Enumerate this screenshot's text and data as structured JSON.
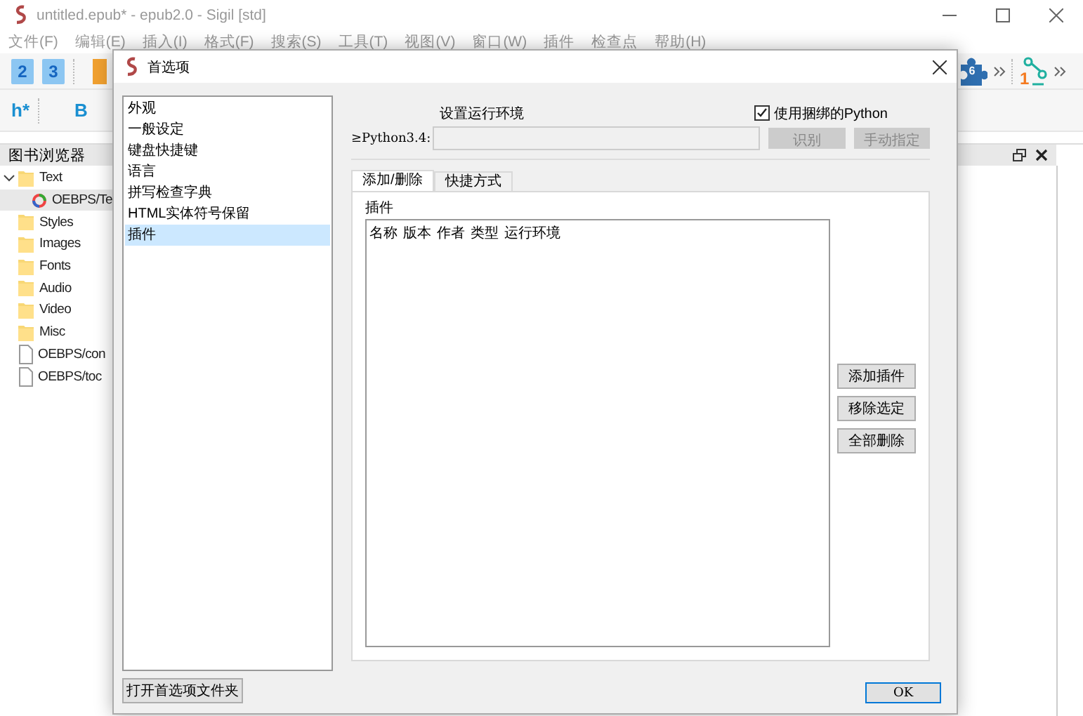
{
  "window": {
    "title": "untitled.epub* - epub2.0 - Sigil [std]"
  },
  "menu": [
    "文件(F)",
    "编辑(E)",
    "插入(I)",
    "格式(F)",
    "搜索(S)",
    "工具(T)",
    "视图(V)",
    "窗口(W)",
    "插件",
    "检查点",
    "帮助(H)"
  ],
  "toolbar_top": {
    "headings": [
      "2",
      "3"
    ],
    "plugin_badge": "6",
    "checkpoint_badge": "1"
  },
  "toolbar_second": {
    "heading_menu": "h*",
    "bold": "B"
  },
  "book_browser": {
    "title": "图书浏览器",
    "tree": [
      {
        "label": "Text",
        "kind": "folder",
        "children": [
          {
            "label": "OEBPS/Te",
            "kind": "html"
          }
        ]
      },
      {
        "label": "Styles",
        "kind": "folder"
      },
      {
        "label": "Images",
        "kind": "folder"
      },
      {
        "label": "Fonts",
        "kind": "folder"
      },
      {
        "label": "Audio",
        "kind": "folder"
      },
      {
        "label": "Video",
        "kind": "folder"
      },
      {
        "label": "Misc",
        "kind": "folder"
      },
      {
        "label": "OEBPS/con",
        "kind": "file"
      },
      {
        "label": "OEBPS/toc",
        "kind": "file"
      }
    ]
  },
  "dialog": {
    "title": "首选项",
    "categories": [
      {
        "label": "外观",
        "selected": false
      },
      {
        "label": "一般设定",
        "selected": false
      },
      {
        "label": "键盘快捷键",
        "selected": false
      },
      {
        "label": "语言",
        "selected": false
      },
      {
        "label": "拼写检查字典",
        "selected": false
      },
      {
        "label": "HTML实体符号保留",
        "selected": false
      },
      {
        "label": "插件",
        "selected": true
      }
    ],
    "open_folder_button": "打开首选项文件夹",
    "section_title": "设置运行环境",
    "use_bundled": {
      "label": "使用捆绑的Python",
      "checked": true
    },
    "python_label": "≥Python3.4:",
    "python_path": {
      "disabled": true
    },
    "identify_button": {
      "label": "识别",
      "disabled": true
    },
    "manual_button": {
      "label": "手动指定",
      "disabled": true
    },
    "tabs": [
      {
        "label": "添加/删除",
        "selected": true
      },
      {
        "label": "快捷方式",
        "selected": false
      }
    ],
    "plugins_label": "插件",
    "plugin_columns": [
      "名称",
      "版本",
      "作者",
      "类型",
      "运行环境"
    ],
    "side_buttons": [
      "添加插件",
      "移除选定",
      "全部删除"
    ],
    "ok_button": "OK"
  }
}
